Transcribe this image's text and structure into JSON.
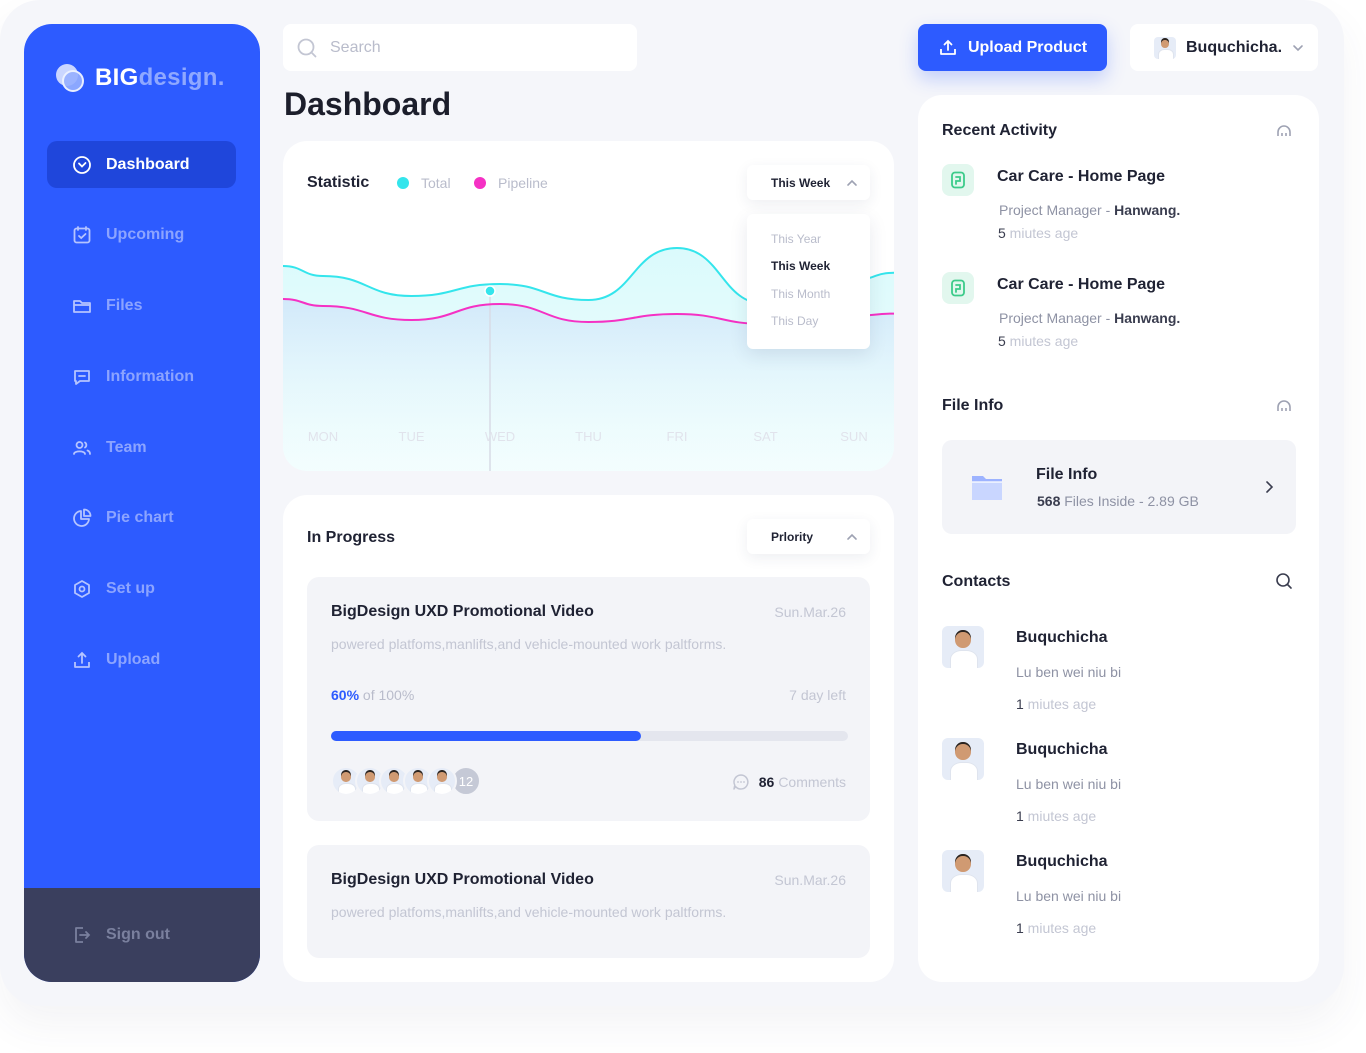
{
  "brand": {
    "part1": "BIG",
    "part2": "design."
  },
  "sidebar": {
    "items": [
      {
        "label": "Dashboard",
        "icon": "dashboard-icon",
        "active": true
      },
      {
        "label": "Upcoming",
        "icon": "calendar-check-icon"
      },
      {
        "label": "Files",
        "icon": "folder-icon"
      },
      {
        "label": "Information",
        "icon": "message-icon"
      },
      {
        "label": "Team",
        "icon": "team-icon"
      },
      {
        "label": "Pie chart",
        "icon": "pie-chart-icon"
      },
      {
        "label": "Set up",
        "icon": "settings-hex-icon"
      },
      {
        "label": "Upload",
        "icon": "upload-icon"
      }
    ],
    "signout": "Sign out"
  },
  "search": {
    "placeholder": "Search"
  },
  "page_title": "Dashboard",
  "upload_button": "Upload Product",
  "user": {
    "name": "Buquchicha."
  },
  "statistic": {
    "title": "Statistic",
    "legend": [
      {
        "label": "Total",
        "color": "#34e5ec"
      },
      {
        "label": "Pipeline",
        "color": "#f531c4"
      }
    ],
    "period_selected": "This Week",
    "period_options": [
      "This Year",
      "This Week",
      "This Month",
      "This Day"
    ]
  },
  "chart_data": {
    "type": "area",
    "categories": [
      "MON",
      "TUE",
      "WED",
      "THU",
      "FRI",
      "SAT",
      "SUN"
    ],
    "series": [
      {
        "name": "Total",
        "color": "#34e5ec",
        "values": [
          70,
          60,
          66,
          58,
          84,
          56,
          68
        ]
      },
      {
        "name": "Pipeline",
        "color": "#f531c4",
        "values": [
          55,
          48,
          56,
          47,
          51,
          46,
          50
        ]
      }
    ],
    "highlight": "WED",
    "grid": false
  },
  "progress": {
    "title": "In Progress",
    "sort_label": "Prlority",
    "tasks": [
      {
        "name": "BigDesign UXD Promotional Video",
        "date": "Sun.Mar.26",
        "desc": "powered platfoms,manlifts,and vehicle-mounted work paltforms.",
        "pct_value": "60%",
        "pct_of": "of 100%",
        "progress": 0.6,
        "days_left": "7 day left",
        "extra_members": "12",
        "comments_count": "86",
        "comments_label": "Comments"
      },
      {
        "name": "BigDesign UXD Promotional Video",
        "date": "Sun.Mar.26",
        "desc": "powered platfoms,manlifts,and vehicle-mounted work paltforms."
      }
    ]
  },
  "recent_activity": {
    "title": "Recent Activity",
    "items": [
      {
        "title": "Car Care - Home Page",
        "role": "Project Manager - ",
        "company": "Hanwang.",
        "time_num": "5",
        "time_text": " miutes age"
      },
      {
        "title": "Car Care - Home Page",
        "role": "Project Manager - ",
        "company": "Hanwang.",
        "time_num": "5",
        "time_text": " miutes age"
      }
    ]
  },
  "file_info": {
    "section_title": "File Info",
    "title": "File Info",
    "count": "568",
    "meta": " Files Inside - 2.89 GB"
  },
  "contacts": {
    "title": "Contacts",
    "items": [
      {
        "name": "Buquchicha",
        "sub": "Lu ben wei niu bi",
        "time_num": "1",
        "time_text": " miutes age"
      },
      {
        "name": "Buquchicha",
        "sub": "Lu ben wei niu bi",
        "time_num": "1",
        "time_text": " miutes age"
      },
      {
        "name": "Buquchicha",
        "sub": "Lu ben wei niu bi",
        "time_num": "1",
        "time_text": " miutes age"
      }
    ]
  }
}
